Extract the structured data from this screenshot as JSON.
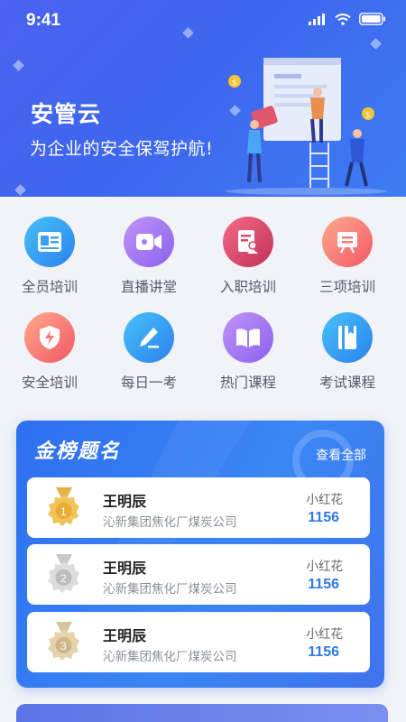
{
  "status": {
    "time": "9:41"
  },
  "hero": {
    "brand": "安管云",
    "slogan": "为企业的安全保驾护航!",
    "colors": {
      "gradient_start": "#4a63f0",
      "gradient_end": "#3d7cf3"
    }
  },
  "grid": {
    "items": [
      {
        "label": "全员培训",
        "icon": "id-card-icon",
        "color_a": "#3fb6f7",
        "color_b": "#2a86ee"
      },
      {
        "label": "直播讲堂",
        "icon": "video-camera-icon",
        "color_a": "#b487f5",
        "color_b": "#8a64ef"
      },
      {
        "label": "入职培训",
        "icon": "document-person-icon",
        "color_a": "#f2607a",
        "color_b": "#c7345e"
      },
      {
        "label": "三项培训",
        "icon": "easel-icon",
        "color_a": "#ff9d8a",
        "color_b": "#f25c63"
      },
      {
        "label": "安全培训",
        "icon": "shield-bolt-icon",
        "color_a": "#ff9d8a",
        "color_b": "#f25c63"
      },
      {
        "label": "每日一考",
        "icon": "pencil-icon",
        "color_a": "#3fb6f7",
        "color_b": "#2a86ee"
      },
      {
        "label": "热门课程",
        "icon": "open-book-icon",
        "color_a": "#b487f5",
        "color_b": "#8a64ef"
      },
      {
        "label": "考试课程",
        "icon": "notebook-icon",
        "color_a": "#3fb6f7",
        "color_b": "#2a86ee"
      }
    ]
  },
  "ranking": {
    "title": "金榜题名",
    "view_all": "查看全部",
    "entries": [
      {
        "rank": "1",
        "medal": "gold-medal-icon",
        "name": "王明辰",
        "company": "沁新集团焦化厂煤炭公司",
        "user": "小红花",
        "score": "1156"
      },
      {
        "rank": "2",
        "medal": "silver-medal-icon",
        "name": "王明辰",
        "company": "沁新集团焦化厂煤炭公司",
        "user": "小红花",
        "score": "1156"
      },
      {
        "rank": "3",
        "medal": "bronze-medal-icon",
        "name": "王明辰",
        "company": "沁新集团焦化厂煤炭公司",
        "user": "小红花",
        "score": "1156"
      }
    ]
  }
}
